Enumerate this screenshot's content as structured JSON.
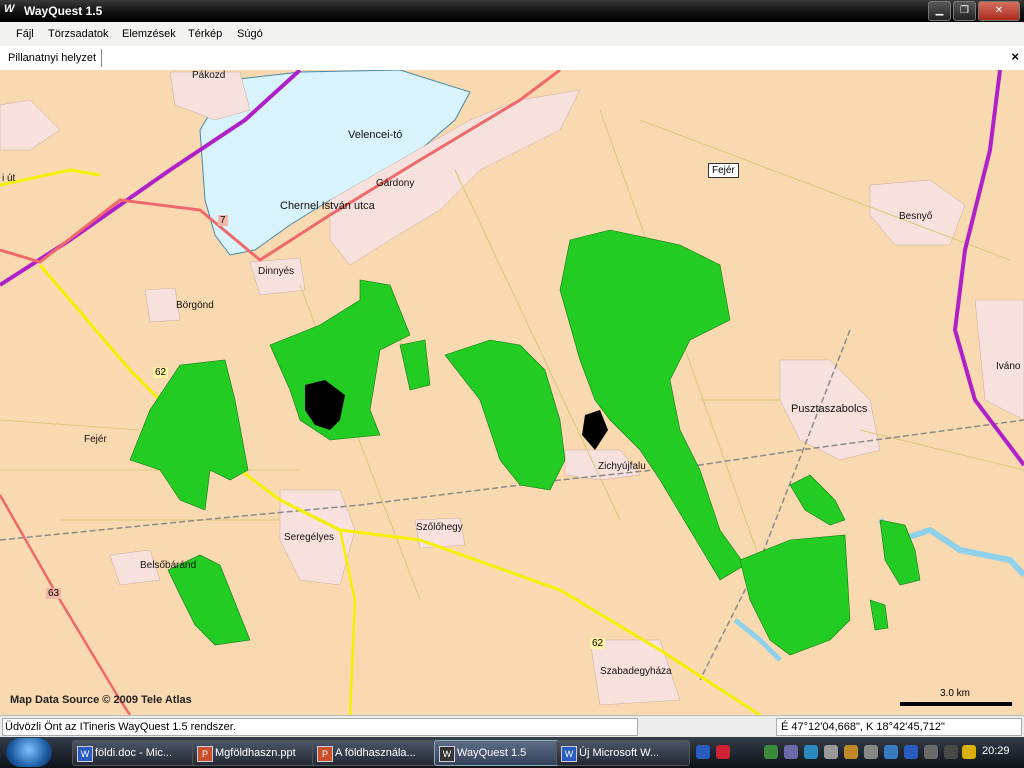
{
  "window": {
    "title": "WayQuest 1.5",
    "icon": "wq-logo-icon",
    "buttons": [
      "minimize-icon",
      "maximize-icon",
      "close-icon"
    ]
  },
  "menu": {
    "items": [
      "Fájl",
      "Törzsadatok",
      "Elemzések",
      "Térkép",
      "Súgó"
    ]
  },
  "tab": {
    "label": "Pillanatnyi helyzet",
    "close": "×"
  },
  "map": {
    "places": [
      "Pákozd",
      "Velencei-tó",
      "Gárdony",
      "Chernel István utca",
      "Dinnyés",
      "Börgönd",
      "Fejér",
      "Besnyő",
      "Pusztaszabolcs",
      "Iváno",
      "Zichyújfalu",
      "Szőlőhegy",
      "Seregélyes",
      "Belsőbáránd",
      "Szabadegyháza",
      "i út"
    ],
    "road_numbers": [
      "7",
      "62",
      "62",
      "63"
    ],
    "county_label": "Fejér",
    "source": "Map Data Source © 2009 Tele Atlas",
    "scale_label": "3.0 km",
    "colors": {
      "land": "#f9d9b0",
      "water": "#d8f3fb",
      "parcel": "#22cc22",
      "town": "#f7e1dc",
      "motorway": "#b020c8",
      "main_road": "#ee6a6a",
      "secondary_road": "#f4f000"
    }
  },
  "status": {
    "message": "Üdvözli Önt az ITineris WayQuest 1.5 rendszer.",
    "coordinates": "É 47°12'04,668\", K 18°42'45,712\""
  },
  "taskbar": {
    "items": [
      {
        "label": "földi.doc - Mic...",
        "icon": "word-icon"
      },
      {
        "label": "Mgföldhaszn.ppt",
        "icon": "powerpoint-icon"
      },
      {
        "label": "A földhasznála...",
        "icon": "powerpoint-icon"
      },
      {
        "label": "WayQuest 1.5",
        "icon": "wq-logo-icon"
      },
      {
        "label": "Új Microsoft W...",
        "icon": "word-icon"
      }
    ],
    "clock": "20:29"
  }
}
